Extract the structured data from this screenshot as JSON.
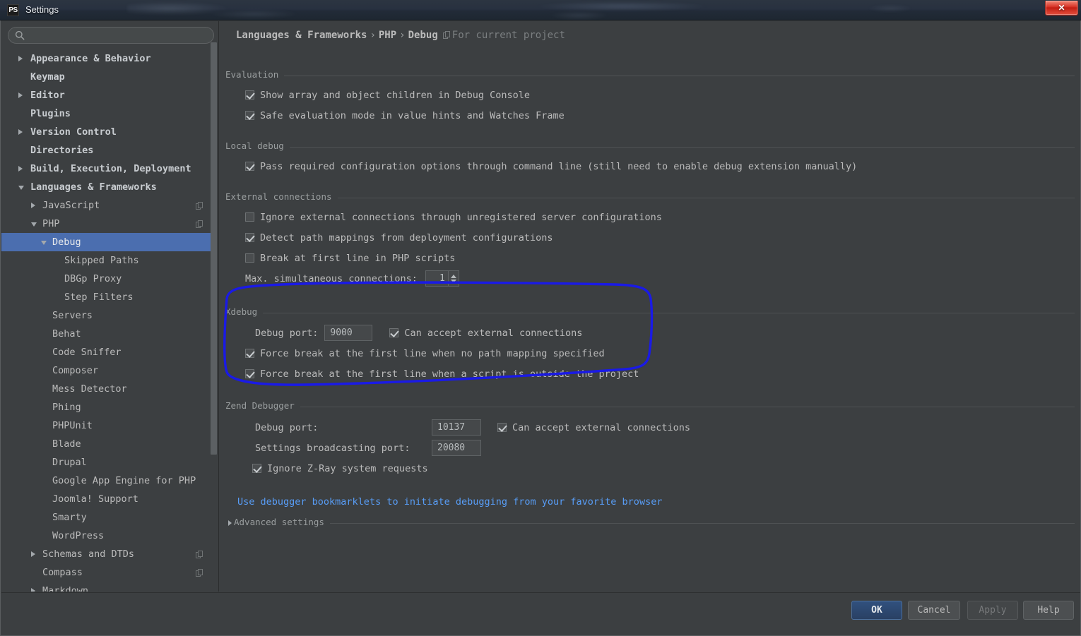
{
  "window": {
    "title": "Settings",
    "app_icon": "PS",
    "close_label": "✕"
  },
  "sidebar": {
    "search": {
      "value": "",
      "placeholder": ""
    },
    "items": [
      {
        "label": "Appearance & Behavior",
        "level": 0,
        "arrow": "closed",
        "selected": false,
        "copy": false
      },
      {
        "label": "Keymap",
        "level": 0,
        "arrow": "none",
        "selected": false,
        "copy": false
      },
      {
        "label": "Editor",
        "level": 0,
        "arrow": "closed",
        "selected": false,
        "copy": false
      },
      {
        "label": "Plugins",
        "level": 0,
        "arrow": "none",
        "selected": false,
        "copy": false
      },
      {
        "label": "Version Control",
        "level": 0,
        "arrow": "closed",
        "selected": false,
        "copy": false
      },
      {
        "label": "Directories",
        "level": 0,
        "arrow": "none",
        "selected": false,
        "copy": false
      },
      {
        "label": "Build, Execution, Deployment",
        "level": 0,
        "arrow": "closed",
        "selected": false,
        "copy": false
      },
      {
        "label": "Languages & Frameworks",
        "level": 0,
        "arrow": "open",
        "selected": false,
        "copy": false
      },
      {
        "label": "JavaScript",
        "level": 1,
        "arrow": "closed",
        "selected": false,
        "copy": true
      },
      {
        "label": "PHP",
        "level": 1,
        "arrow": "open",
        "selected": false,
        "copy": true
      },
      {
        "label": "Debug",
        "level": 2,
        "arrow": "open",
        "selected": true,
        "copy": false
      },
      {
        "label": "Skipped Paths",
        "level": 3,
        "arrow": "none",
        "selected": false,
        "copy": false
      },
      {
        "label": "DBGp Proxy",
        "level": 3,
        "arrow": "none",
        "selected": false,
        "copy": false
      },
      {
        "label": "Step Filters",
        "level": 3,
        "arrow": "none",
        "selected": false,
        "copy": false
      },
      {
        "label": "Servers",
        "level": 2,
        "arrow": "none",
        "selected": false,
        "copy": false
      },
      {
        "label": "Behat",
        "level": 2,
        "arrow": "none",
        "selected": false,
        "copy": false
      },
      {
        "label": "Code Sniffer",
        "level": 2,
        "arrow": "none",
        "selected": false,
        "copy": false
      },
      {
        "label": "Composer",
        "level": 2,
        "arrow": "none",
        "selected": false,
        "copy": false
      },
      {
        "label": "Mess Detector",
        "level": 2,
        "arrow": "none",
        "selected": false,
        "copy": false
      },
      {
        "label": "Phing",
        "level": 2,
        "arrow": "none",
        "selected": false,
        "copy": false
      },
      {
        "label": "PHPUnit",
        "level": 2,
        "arrow": "none",
        "selected": false,
        "copy": false
      },
      {
        "label": "Blade",
        "level": 2,
        "arrow": "none",
        "selected": false,
        "copy": false
      },
      {
        "label": "Drupal",
        "level": 2,
        "arrow": "none",
        "selected": false,
        "copy": false
      },
      {
        "label": "Google App Engine for PHP",
        "level": 2,
        "arrow": "none",
        "selected": false,
        "copy": false
      },
      {
        "label": "Joomla! Support",
        "level": 2,
        "arrow": "none",
        "selected": false,
        "copy": false
      },
      {
        "label": "Smarty",
        "level": 2,
        "arrow": "none",
        "selected": false,
        "copy": false
      },
      {
        "label": "WordPress",
        "level": 2,
        "arrow": "none",
        "selected": false,
        "copy": false
      },
      {
        "label": "Schemas and DTDs",
        "level": 1,
        "arrow": "closed",
        "selected": false,
        "copy": true
      },
      {
        "label": "Compass",
        "level": 1,
        "arrow": "none",
        "selected": false,
        "copy": true
      },
      {
        "label": "Markdown",
        "level": 1,
        "arrow": "closed",
        "selected": false,
        "copy": false
      }
    ]
  },
  "breadcrumb": {
    "part1": "Languages & Frameworks",
    "sep1": "›",
    "part2": "PHP",
    "sep2": "›",
    "part3": "Debug",
    "project_scope": "For current project"
  },
  "sections": {
    "evaluation": {
      "title": "Evaluation",
      "options": [
        {
          "label": "Show array and object children in Debug Console",
          "checked": true
        },
        {
          "label": "Safe evaluation mode in value hints and Watches Frame",
          "checked": true
        }
      ]
    },
    "local_debug": {
      "title": "Local debug",
      "options": [
        {
          "label": "Pass required configuration options through command line (still need to enable debug extension manually)",
          "checked": true
        }
      ]
    },
    "external_connections": {
      "title": "External connections",
      "options": [
        {
          "label": "Ignore external connections through unregistered server configurations",
          "checked": false
        },
        {
          "label": "Detect path mappings from deployment configurations",
          "checked": true
        },
        {
          "label": "Break at first line in PHP scripts",
          "checked": false
        }
      ],
      "max_connections_label": "Max. simultaneous connections:",
      "max_connections_value": "1"
    },
    "xdebug": {
      "title": "Xdebug",
      "debug_port_label": "Debug port:",
      "debug_port_value": "9000",
      "can_accept_label": "Can accept external connections",
      "can_accept_checked": true,
      "options": [
        {
          "label": "Force break at the first line when no path mapping specified",
          "checked": true
        },
        {
          "label": "Force break at the first line when a script is outside the project",
          "checked": true
        }
      ]
    },
    "zend_debugger": {
      "title": "Zend Debugger",
      "debug_port_label": "Debug port:",
      "debug_port_value": "10137",
      "can_accept_label": "Can accept external connections",
      "can_accept_checked": true,
      "broadcast_label": "Settings broadcasting port:",
      "broadcast_value": "20080",
      "ignore_zray_label": "Ignore Z-Ray system requests",
      "ignore_zray_checked": true
    },
    "bookmarklets_link": "Use debugger bookmarklets to initiate debugging from your favorite browser",
    "advanced_settings": "Advanced settings"
  },
  "footer": {
    "ok": "OK",
    "cancel": "Cancel",
    "apply": "Apply",
    "help": "Help"
  },
  "colors": {
    "accent_selection": "#4b6eaf",
    "link": "#589df6",
    "annotation": "#1a1ae6",
    "background": "#3c3f41",
    "text": "#bbbbbb"
  }
}
